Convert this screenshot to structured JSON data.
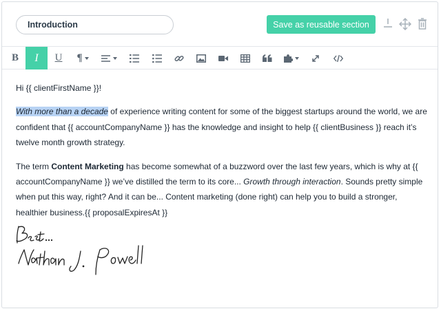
{
  "section": {
    "title_value": "Introduction",
    "save_label": "Save as reusable section"
  },
  "header_icons": [
    "minus-icon",
    "move-icon",
    "trash-icon"
  ],
  "toolbar": {
    "items": [
      {
        "name": "bold",
        "label": "B"
      },
      {
        "name": "italic",
        "label": "I",
        "active": true
      },
      {
        "name": "underline",
        "label": "U"
      },
      {
        "name": "paragraph",
        "label": "¶"
      },
      {
        "name": "align"
      },
      {
        "name": "ordered-list"
      },
      {
        "name": "unordered-list"
      },
      {
        "name": "link"
      },
      {
        "name": "image"
      },
      {
        "name": "video"
      },
      {
        "name": "table"
      },
      {
        "name": "quote"
      },
      {
        "name": "plugin"
      },
      {
        "name": "fullscreen"
      },
      {
        "name": "code"
      }
    ]
  },
  "content": {
    "greeting": "Hi {{ clientFirstName }}!",
    "p2_highlight": "With more than a decade",
    "p2_rest": " of experience writing content for some of the biggest startups around the world, we are confident that {{ accountCompanyName }} has the knowledge and insight to help {{ clientBusiness }} reach it’s twelve month growth strategy.",
    "p3_a": "The term ",
    "p3_bold": "Content Marketing",
    "p3_b": " has become somewhat of a buzzword over the last few years, which is why at {{ accountCompanyName }} we’ve distilled the term to its core... ",
    "p3_italic": "Growth through interaction",
    "p3_c": ". Sounds pretty simple when put this way, right? And it can be... Content marketing (done right) can help you to build a stronger, healthier business.{{ proposalExpiresAt }}",
    "signature_text": "Best... Nathan J. Powell"
  },
  "colors": {
    "accent": "#45d1a8",
    "highlight": "#b8d3f4",
    "icon": "#5b6773"
  }
}
